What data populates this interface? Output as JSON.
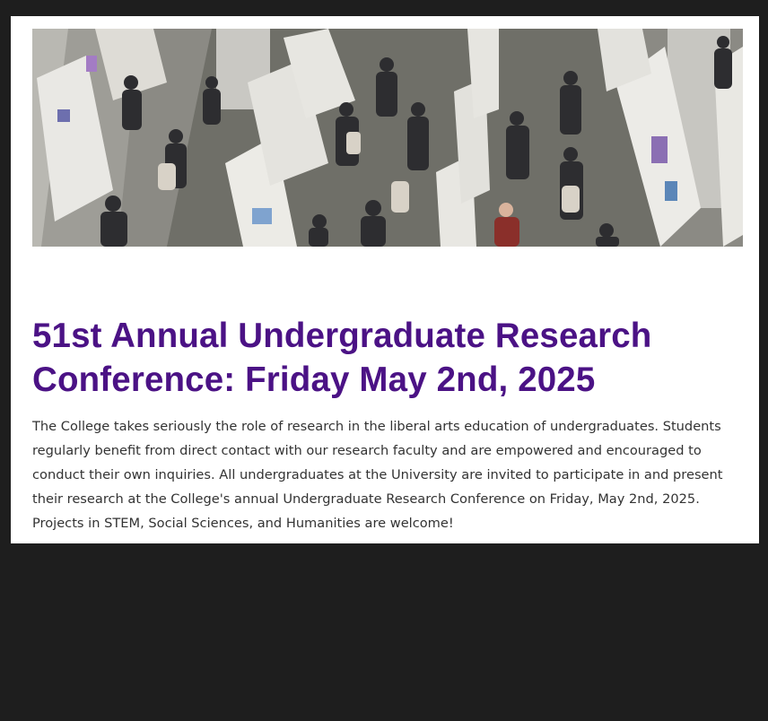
{
  "hero_image": {
    "description_icon": "photo-icon"
  },
  "article": {
    "title": "51st Annual Undergraduate Research Conference: Friday May 2nd, 2025",
    "body": "The College takes seriously the role of research in the liberal arts education of undergraduates. Students regularly benefit from direct contact with our research faculty and are empowered and encouraged to conduct their own inquiries. All undergraduates at the University are invited to participate in and present their research at the College's annual Undergraduate Research Conference on Friday, May 2nd, 2025. Projects in STEM, Social Sciences, and Humanities are welcome!"
  },
  "colors": {
    "page_background": "#1e1e1e",
    "card_background": "#ffffff",
    "title": "#4b1285",
    "body_text": "#333333"
  }
}
